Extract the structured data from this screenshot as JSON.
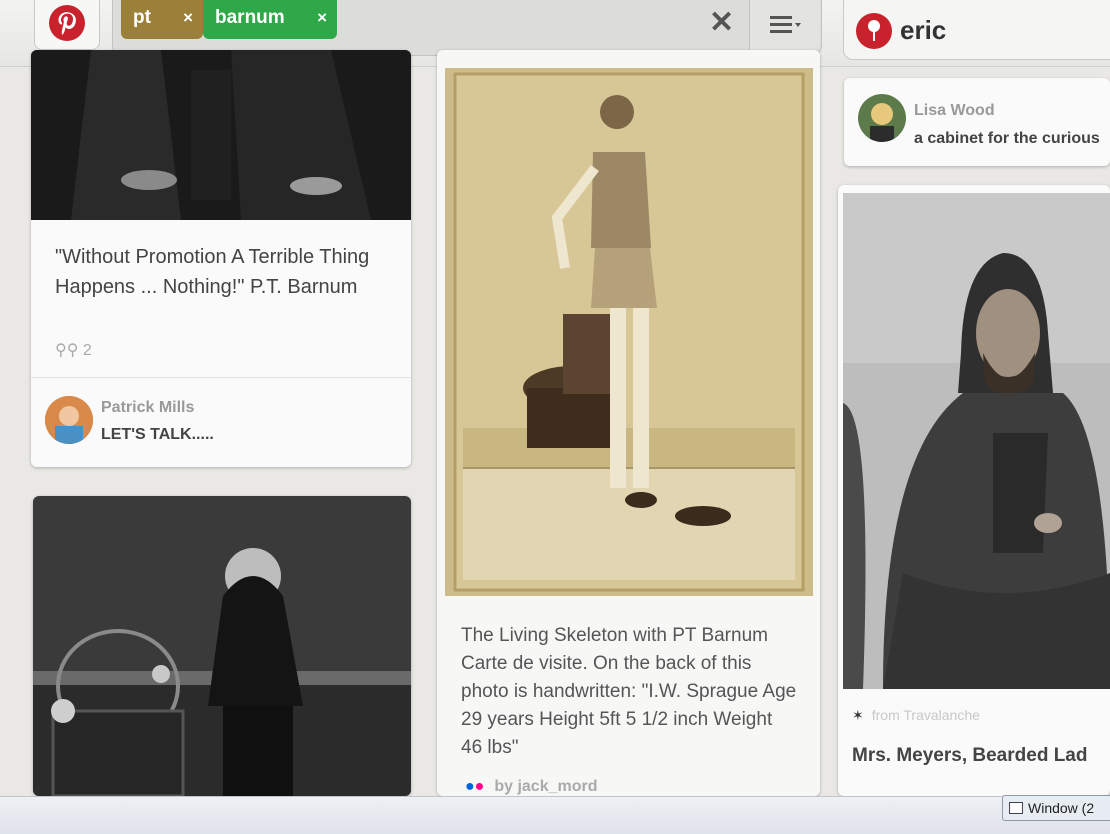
{
  "search": {
    "tags": [
      {
        "label": "pt",
        "remove": "×"
      },
      {
        "label": "barnum",
        "remove": "×"
      }
    ],
    "clear": "✕"
  },
  "user": {
    "name": "eric"
  },
  "pins": {
    "left_top": {
      "description": "\"Without Promotion A Terrible Thing Happens ... Nothing!\" P.T. Barnum",
      "repin_count": "2",
      "pinner_name": "Patrick Mills",
      "board_name": "LET'S TALK....."
    },
    "middle": {
      "description": "The Living Skeleton with PT Barnum Carte de visite. On the back of this photo is handwritten: \"I.W. Sprague Age 29 years Height 5ft 5 1/2 inch Weight 46 lbs\"",
      "source": "by jack_mord"
    },
    "right_top": {
      "pinner_name": "Lisa Wood",
      "board_name": "a cabinet for the curious"
    },
    "right_bottom": {
      "source": "from Travalanche",
      "description": "Mrs. Meyers, Bearded Lad"
    }
  },
  "taskbar": {
    "window_label": "Window (2"
  },
  "colors": {
    "pinterest_red": "#c8232c",
    "tag_pt": "#9a8038",
    "tag_barnum": "#2fa84a"
  }
}
